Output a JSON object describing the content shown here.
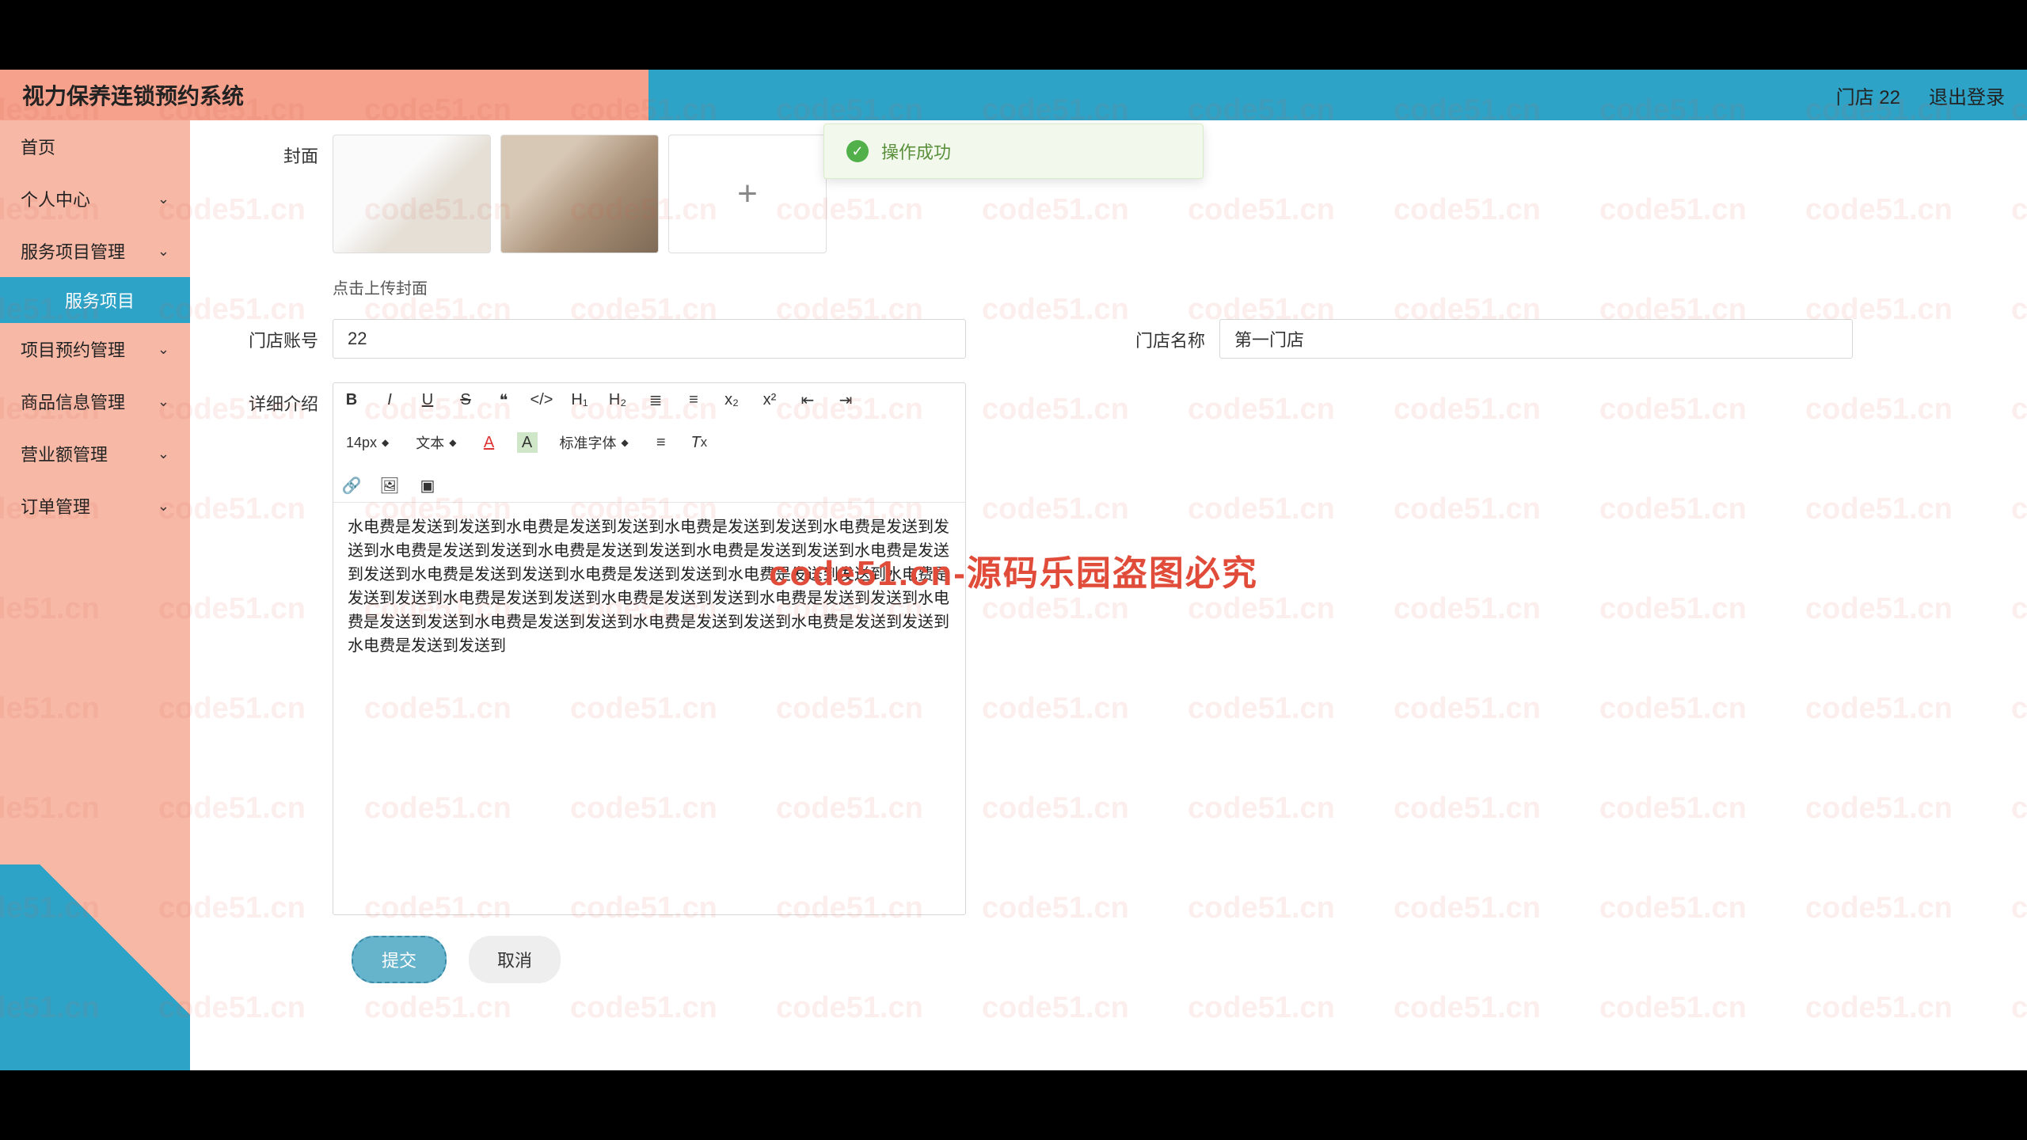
{
  "header": {
    "title": "视力保养连锁预约系统",
    "store": "门店 22",
    "logout": "退出登录"
  },
  "sidebar": {
    "items": [
      {
        "label": "首页"
      },
      {
        "label": "个人中心"
      },
      {
        "label": "服务项目管理"
      },
      {
        "label": "项目预约管理"
      },
      {
        "label": "商品信息管理"
      },
      {
        "label": "营业额管理"
      },
      {
        "label": "订单管理"
      }
    ],
    "sub": {
      "label": "服务项目"
    }
  },
  "form": {
    "coverLabel": "封面",
    "uploadTip": "点击上传封面",
    "addIcon": "+",
    "accountLabel": "门店账号",
    "accountValue": "22",
    "storeNameLabel": "门店名称",
    "storeNameValue": "第一门店",
    "descLabel": "详细介绍",
    "descText": "水电费是发送到发送到水电费是发送到发送到水电费是发送到发送到水电费是发送到发送到水电费是发送到发送到水电费是发送到发送到水电费是发送到发送到水电费是发送到发送到水电费是发送到发送到水电费是发送到发送到水电费是发送到发送到水电费是发送到发送到水电费是发送到发送到水电费是发送到发送到水电费是发送到发送到水电费是发送到发送到水电费是发送到发送到水电费是发送到发送到水电费是发送到发送到水电费是发送到发送到"
  },
  "editorToolbar": {
    "fontSize": "14px",
    "styleSel": "文本",
    "fontFamily": "标准字体"
  },
  "actions": {
    "submit": "提交",
    "cancel": "取消"
  },
  "toast": {
    "text": "操作成功"
  },
  "watermark": {
    "text": "code51.cn",
    "center": "code51.cn-源码乐园盗图必究"
  }
}
